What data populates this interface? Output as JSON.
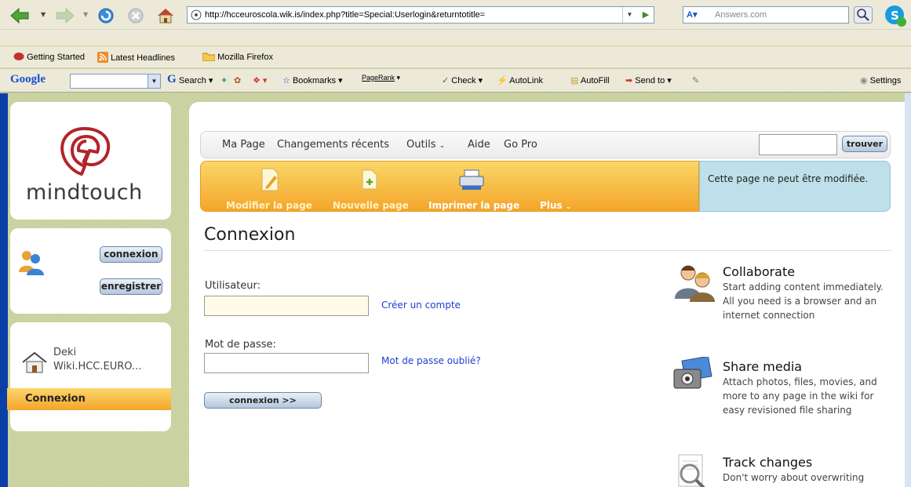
{
  "browser": {
    "url": "http://hcceuroscola.wik.is/index.php?title=Special:Userlogin&returntotitle=",
    "search_placeholder": "Answers.com",
    "bookmarks": [
      "Getting Started",
      "Latest Headlines",
      "Mozilla Firefox"
    ],
    "google_toolbar": {
      "logo": "Google",
      "search": "Search",
      "bookmarks": "Bookmarks",
      "pagerank": "PageRank",
      "check": "Check",
      "autolink": "AutoLink",
      "autofill": "AutoFill",
      "sendto": "Send to",
      "settings": "Settings"
    }
  },
  "sidebar": {
    "logo_text": "mindtouch",
    "login_button": "connexion",
    "register_button": "enregistrer",
    "home_link": "Deki Wiki.HCC.EURO...",
    "current_page": "Connexion"
  },
  "topnav": {
    "items": [
      "Ma Page",
      "Changements récents",
      "Outils",
      "Aide",
      "Go Pro"
    ],
    "search_button": "trouver"
  },
  "toolbar": {
    "edit": "Modifier la page",
    "new": "Nouvelle page",
    "print": "Imprimer la page",
    "more": "Plus"
  },
  "notice": "Cette page ne peut être modifiée.",
  "login": {
    "title": "Connexion",
    "username_label": "Utilisateur:",
    "create_account": "Créer un compte",
    "password_label": "Mot de passe:",
    "forgot_password": "Mot de passe oublié?",
    "submit": "connexion >>"
  },
  "features": [
    {
      "title": "Collaborate",
      "text": "Start adding content immediately.  All you need is a browser and an internet connection",
      "icon": "people-icon"
    },
    {
      "title": "Share media",
      "text": "Attach photos, files, movies, and more to any page in the wiki for easy revisioned file sharing",
      "icon": "camera-photo-icon"
    },
    {
      "title": "Track changes",
      "text": "Don't worry about overwriting",
      "icon": "magnifier-document-icon"
    }
  ]
}
